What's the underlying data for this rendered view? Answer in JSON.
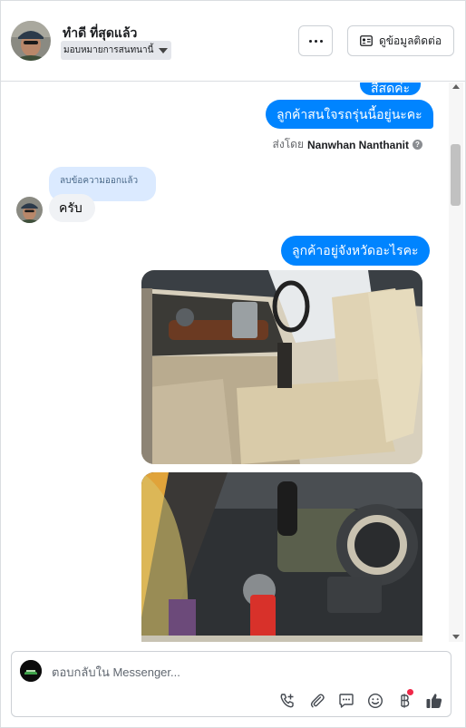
{
  "header": {
    "contact_name": "ทำดี ที่สุดแล้ว",
    "assign_label": "มอบหมายการสนทนานี้",
    "more_label": "···",
    "contact_info_label": "ดูข้อมูลติดต่อ"
  },
  "messages": {
    "partial_outgoing": "สีสดค่ะ",
    "outgoing_1": "ลูกค้าสนใจรถรุ่นนี้อยู่นะคะ",
    "sent_by_prefix": "ส่งโดย",
    "sent_by_name": "Nanwhan Nanthanit",
    "deleted_notice": "ลบข้อความออกแล้ว",
    "incoming_1": "ครับ",
    "outgoing_2": "ลูกค้าอยู่จังหวัดอะไรคะ",
    "photos": [
      {
        "name": "car-interior-seats-photo"
      },
      {
        "name": "car-dashboard-ignition-photo"
      }
    ]
  },
  "composer": {
    "placeholder": "ตอบกลับใน Messenger...",
    "icons": [
      "call-add-icon",
      "attachment-icon",
      "saved-reply-icon",
      "emoji-icon",
      "baht-payment-icon",
      "thumbs-up-icon"
    ]
  },
  "colors": {
    "accent": "#0084ff",
    "deleted_bubble": "#dbeaff",
    "incoming_bubble": "#f0f2f5",
    "notification": "#f02849"
  }
}
